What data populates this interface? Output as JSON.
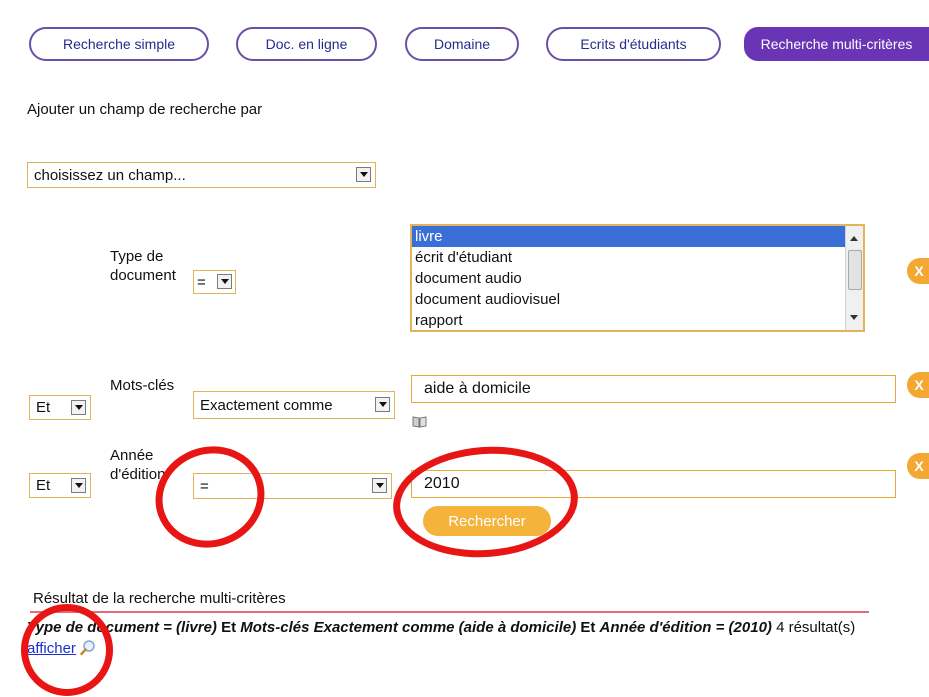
{
  "tabs": [
    {
      "label": "Recherche simple"
    },
    {
      "label": "Doc. en ligne"
    },
    {
      "label": "Domaine"
    },
    {
      "label": "Ecrits d'étudiants"
    },
    {
      "label": "Recherche multi-critères"
    }
  ],
  "add_field": {
    "label": "Ajouter un champ de recherche par",
    "select_value": "choisissez un champ..."
  },
  "rows": {
    "type_doc": {
      "label": "Type de document",
      "operator": "=",
      "options": [
        "livre",
        "écrit d'étudiant",
        "document audio",
        "document audiovisuel",
        "rapport"
      ],
      "selected_option": "livre",
      "remove_label": "X"
    },
    "keywords": {
      "connector": "Et",
      "label": "Mots-clés",
      "operator": "Exactement comme",
      "value": "aide à domicile",
      "remove_label": "X"
    },
    "year": {
      "connector": "Et",
      "label": "Année d'édition",
      "operator": "=",
      "value": "2010",
      "remove_label": "X"
    }
  },
  "search_button": "Rechercher",
  "result": {
    "title": "Résultat de la recherche multi-critères",
    "part1": "Type de document = (livre)",
    "and1": "Et",
    "part2": "Mots-clés Exactement comme (aide à domicile)",
    "and2": "Et",
    "part3": "Année d'édition = (2010)",
    "count_text": "4 résultat(s)",
    "show_link": "afficher"
  },
  "colors": {
    "tab_border": "#6a4fa6",
    "tab_active": "#6a35b5",
    "accent_orange": "#f2a832",
    "highlight_red": "#e81515",
    "selected_blue": "#3b6fd8"
  }
}
